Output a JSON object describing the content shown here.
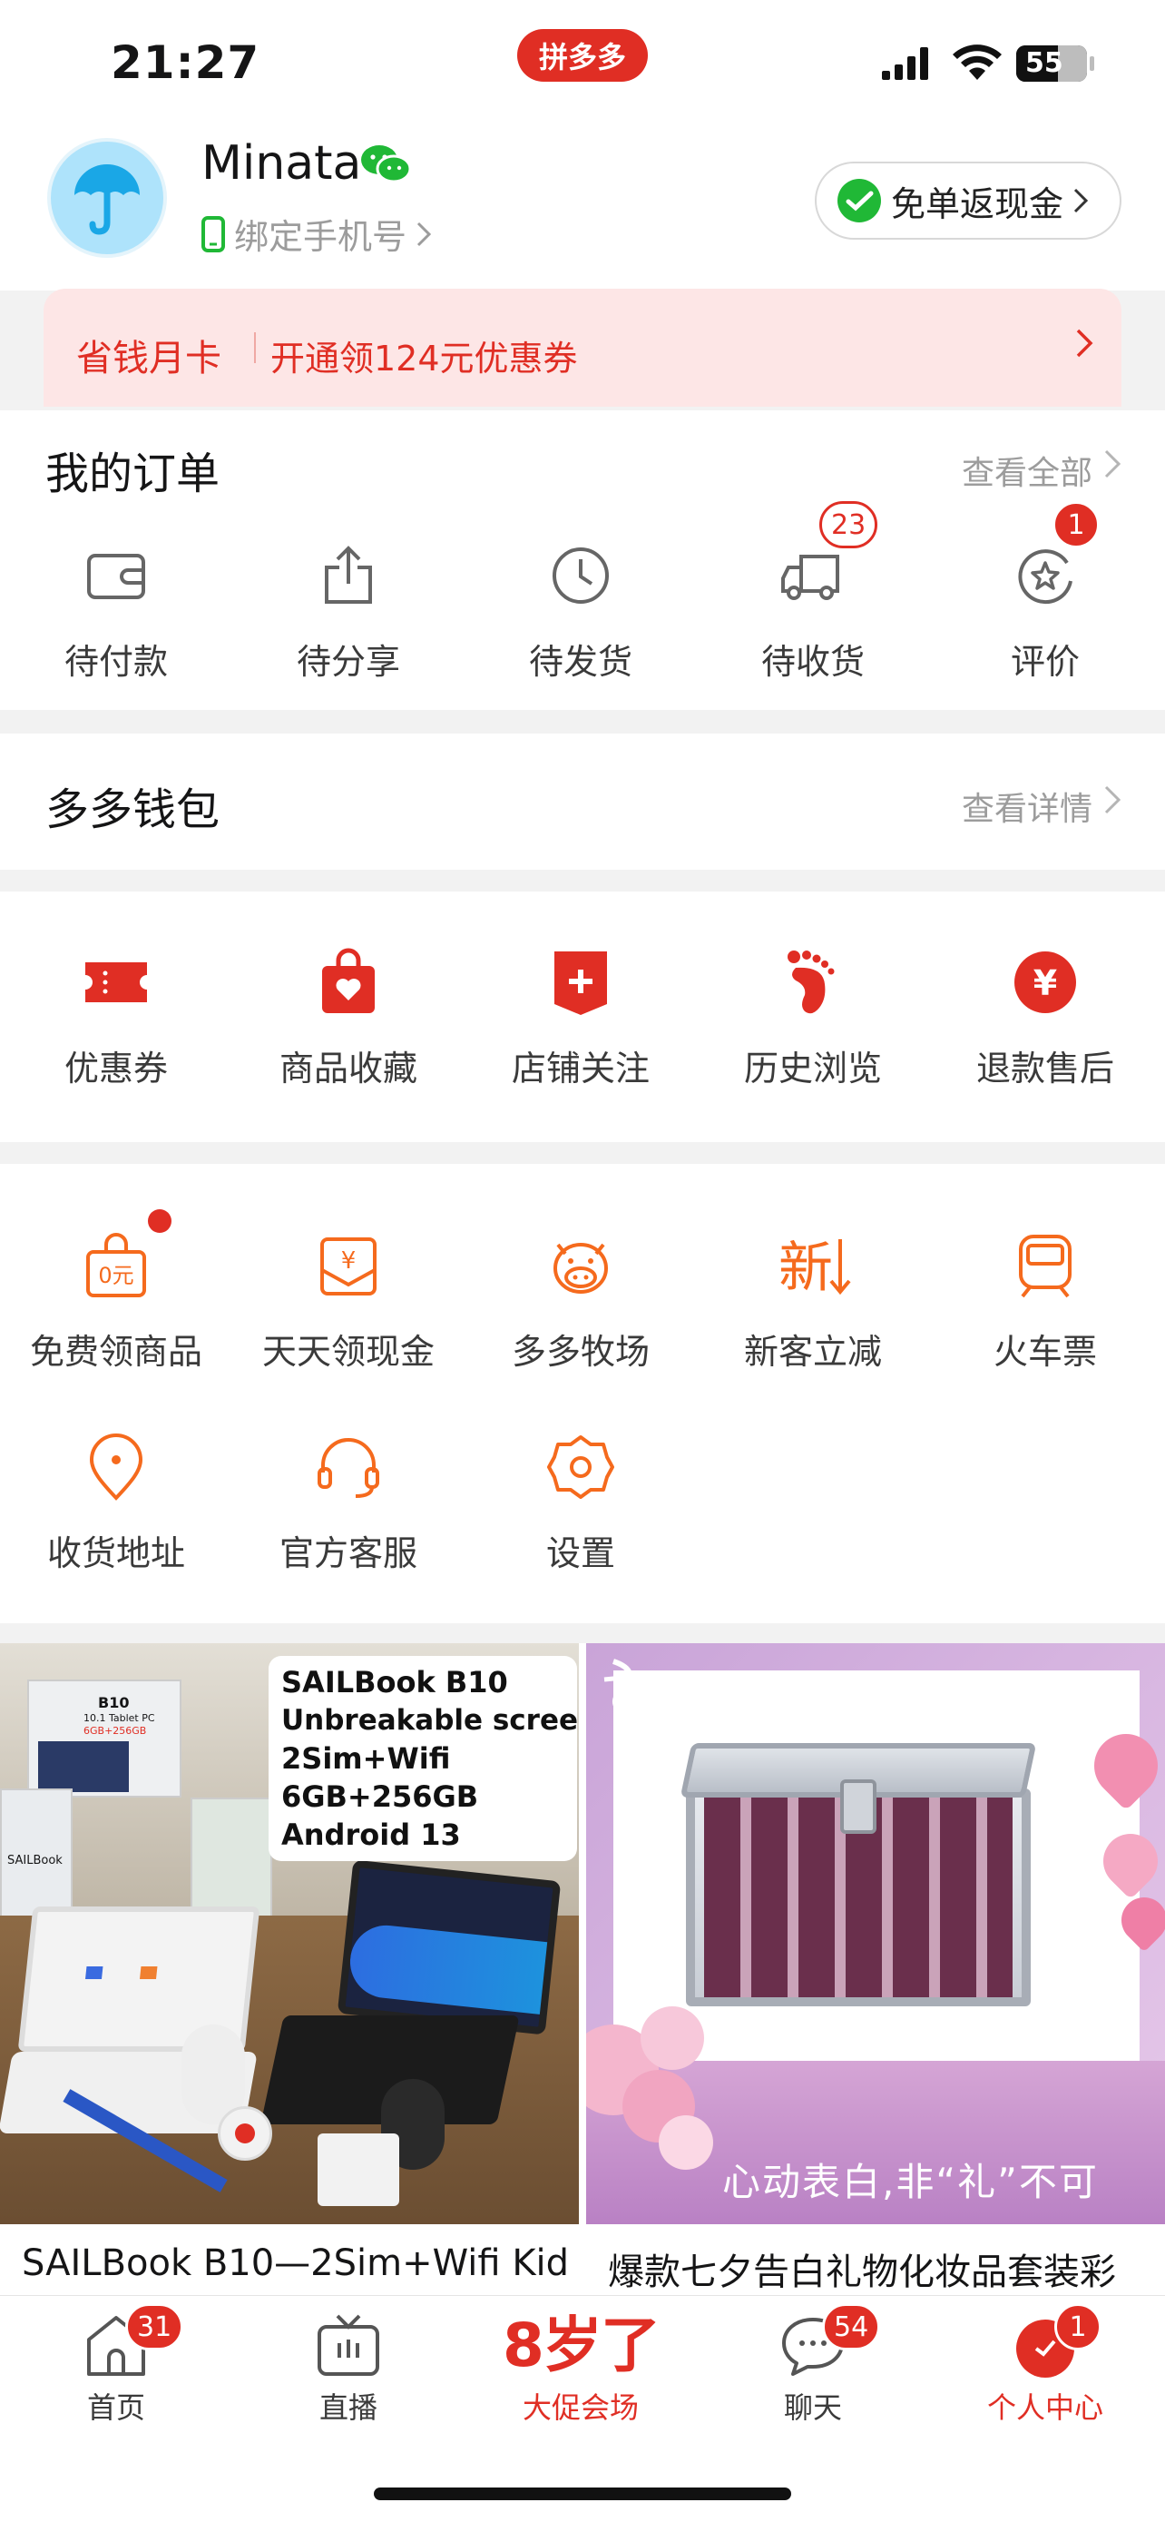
{
  "status_bar": {
    "time": "21:27",
    "battery": "55",
    "brand": "拼多多"
  },
  "profile": {
    "username": "Minata",
    "bind_phone": "绑定手机号",
    "cashback_button": "免单返现金"
  },
  "monthly_card": {
    "title": "省钱月卡",
    "subtitle": "开通领124元优惠券"
  },
  "orders": {
    "title": "我的订单",
    "view_all": "查看全部",
    "items": [
      {
        "label": "待付款",
        "icon": "wallet-icon",
        "badge": ""
      },
      {
        "label": "待分享",
        "icon": "share-icon",
        "badge": ""
      },
      {
        "label": "待发货",
        "icon": "clock-icon",
        "badge": ""
      },
      {
        "label": "待收货",
        "icon": "truck-icon",
        "badge": "23"
      },
      {
        "label": "评价",
        "icon": "review-icon",
        "badge": "1"
      }
    ]
  },
  "wallet": {
    "title": "多多钱包",
    "view_details": "查看详情"
  },
  "quick": {
    "items": [
      {
        "label": "优惠券",
        "icon": "coupon-icon"
      },
      {
        "label": "商品收藏",
        "icon": "favorite-bag-icon"
      },
      {
        "label": "店铺关注",
        "icon": "store-follow-icon"
      },
      {
        "label": "历史浏览",
        "icon": "footprint-icon"
      },
      {
        "label": "退款售后",
        "icon": "refund-icon"
      }
    ]
  },
  "services": {
    "items": [
      {
        "label": "免费领商品",
        "icon": "free-bag-icon",
        "icon_text": "0元"
      },
      {
        "label": "天天领现金",
        "icon": "cash-envelope-icon",
        "icon_text": "¥"
      },
      {
        "label": "多多牧场",
        "icon": "cow-icon",
        "icon_text": ""
      },
      {
        "label": "新客立减",
        "icon": "new-customer-icon",
        "icon_text": "新"
      },
      {
        "label": "火车票",
        "icon": "train-icon",
        "icon_text": ""
      },
      {
        "label": "收货地址",
        "icon": "location-icon",
        "icon_text": ""
      },
      {
        "label": "官方客服",
        "icon": "headset-icon",
        "icon_text": ""
      },
      {
        "label": "设置",
        "icon": "settings-icon",
        "icon_text": ""
      }
    ]
  },
  "products": [
    {
      "title": "SAILBook B10—2Sim+Wifi Kid",
      "overlay": [
        "SAILBook B10",
        "Unbreakable screen",
        "2Sim+Wifi",
        "6GB+256GB",
        "Android 13"
      ],
      "small_labels": [
        "B10",
        "10.1 Tablet PC",
        "6GB+256GB",
        "SAILBook"
      ]
    },
    {
      "title": "爆款七夕告白礼物化妆品套装彩",
      "overlay": [
        "心动表白,非“礼”不可"
      ]
    }
  ],
  "tabbar": [
    {
      "label": "首页",
      "icon": "home-icon",
      "badge": "31"
    },
    {
      "label": "直播",
      "icon": "live-tv-icon",
      "badge": ""
    },
    {
      "label": "大促会场",
      "icon": "promo-icon",
      "badge": "",
      "promo_text": "8岁了"
    },
    {
      "label": "聊天",
      "icon": "chat-icon",
      "badge": "54"
    },
    {
      "label": "个人中心",
      "icon": "profile-icon",
      "badge": "1"
    }
  ],
  "colors": {
    "accent": "#e02e24",
    "service_orange": "#f56a1d",
    "muted": "#9c9c9c"
  }
}
